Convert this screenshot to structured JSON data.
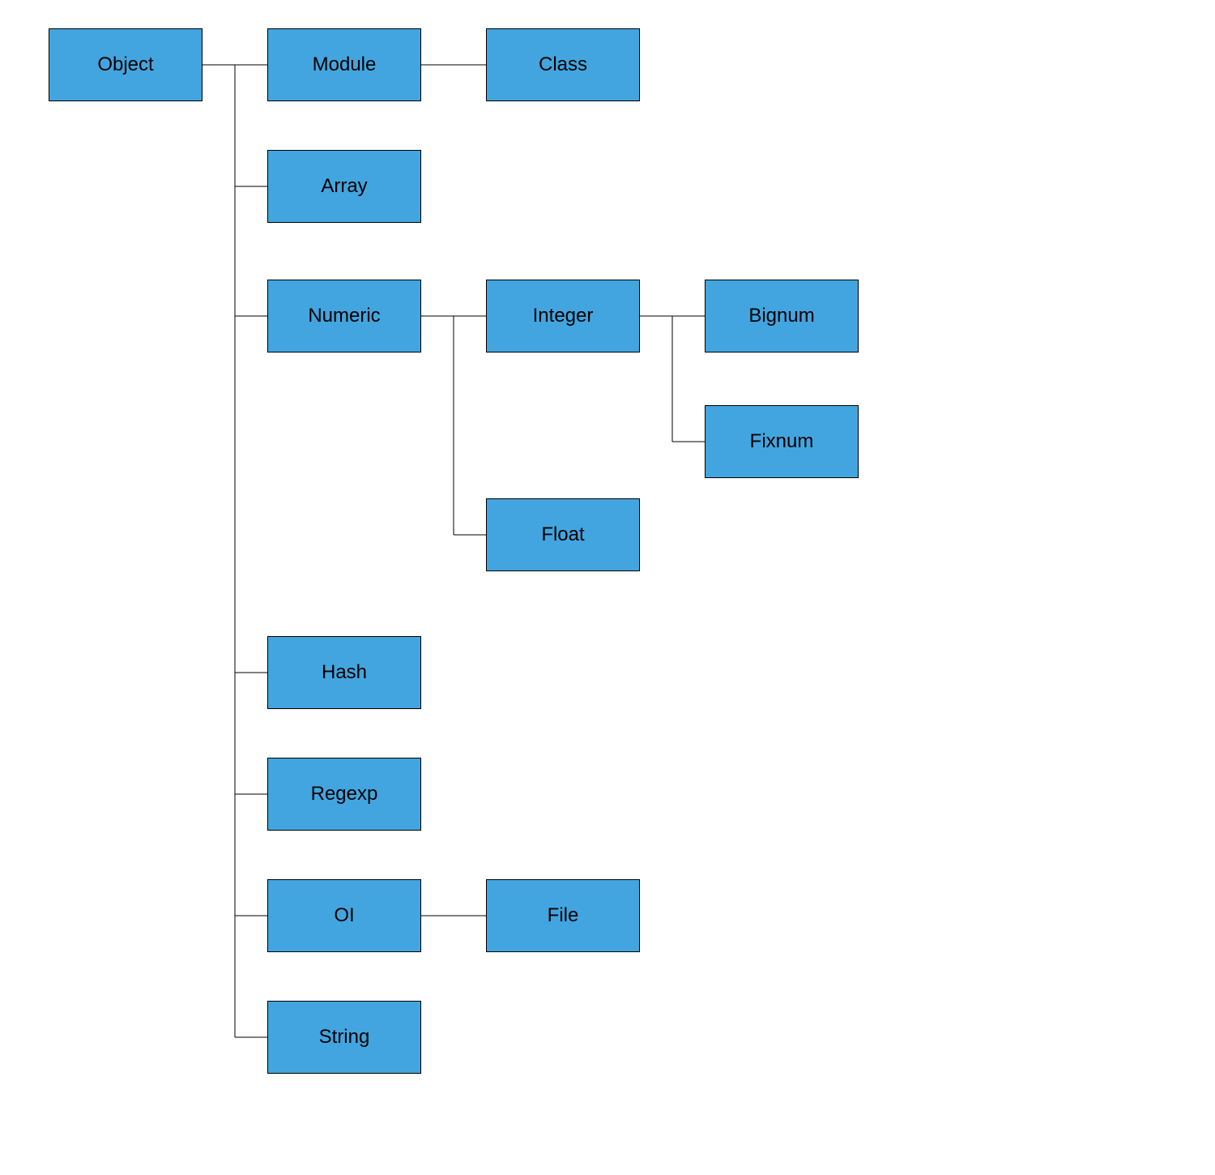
{
  "diagram": {
    "type": "class-hierarchy-tree",
    "node_fill": "#42a5df",
    "node_border": "#000000",
    "nodes": {
      "object": {
        "label": "Object"
      },
      "module": {
        "label": "Module"
      },
      "class": {
        "label": "Class"
      },
      "array": {
        "label": "Array"
      },
      "numeric": {
        "label": "Numeric"
      },
      "integer": {
        "label": "Integer"
      },
      "bignum": {
        "label": "Bignum"
      },
      "fixnum": {
        "label": "Fixnum"
      },
      "float": {
        "label": "Float"
      },
      "hash": {
        "label": "Hash"
      },
      "regexp": {
        "label": "Regexp"
      },
      "oi": {
        "label": "OI"
      },
      "file": {
        "label": "File"
      },
      "string": {
        "label": "String"
      }
    },
    "edges": [
      [
        "object",
        "module"
      ],
      [
        "module",
        "class"
      ],
      [
        "object",
        "array"
      ],
      [
        "object",
        "numeric"
      ],
      [
        "numeric",
        "integer"
      ],
      [
        "integer",
        "bignum"
      ],
      [
        "integer",
        "fixnum"
      ],
      [
        "numeric",
        "float"
      ],
      [
        "object",
        "hash"
      ],
      [
        "object",
        "regexp"
      ],
      [
        "object",
        "oi"
      ],
      [
        "oi",
        "file"
      ],
      [
        "object",
        "string"
      ]
    ]
  }
}
